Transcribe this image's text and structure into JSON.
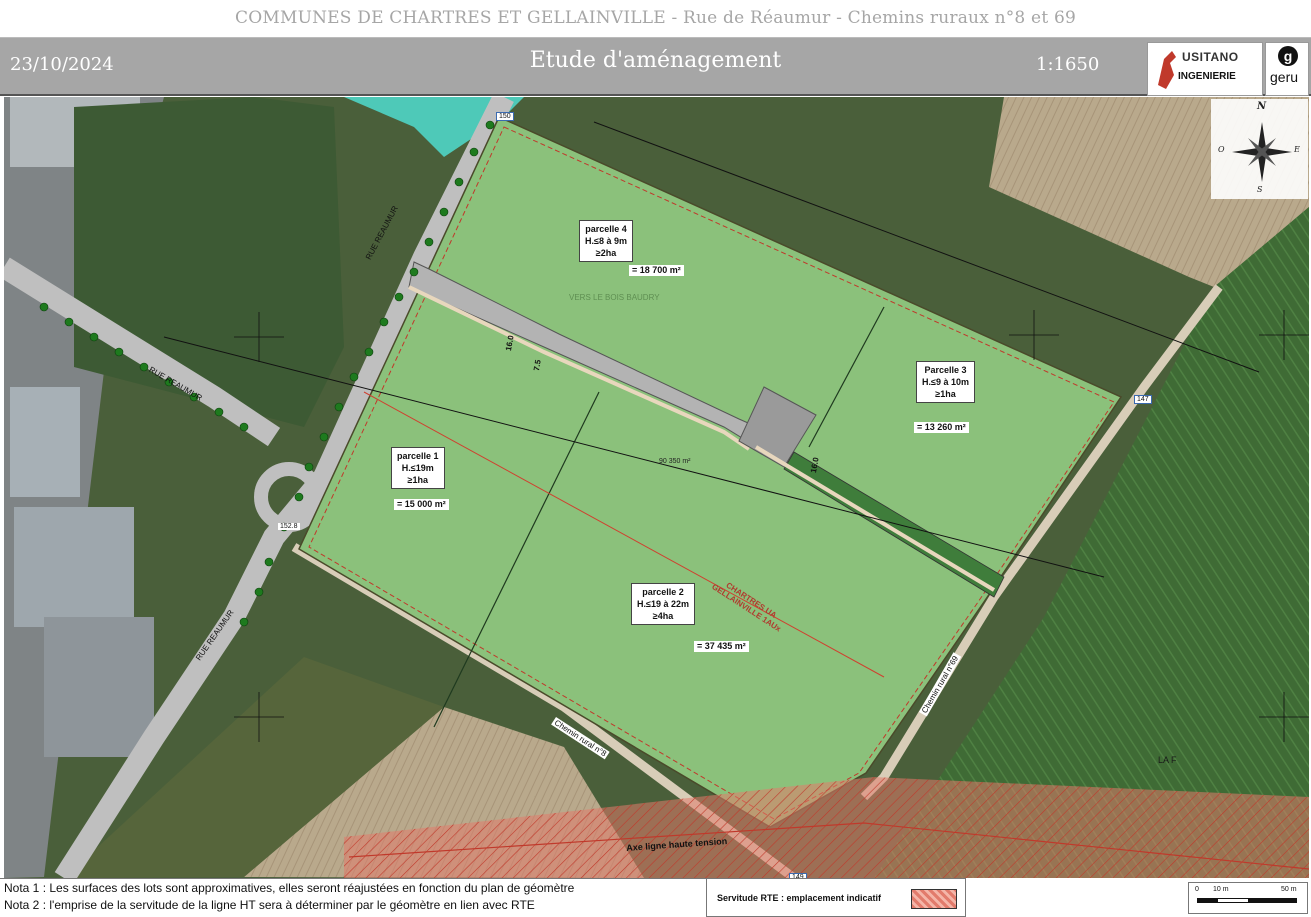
{
  "topbar": {
    "title": "COMMUNES DE CHARTRES ET GELLAINVILLE - Rue de Réaumur - Chemins ruraux n°8 et 69"
  },
  "header": {
    "date": "23/10/2024",
    "study_title": "Etude d'aménagement",
    "scale": "1:1650",
    "logo_lusitano_name": "USITANO",
    "logo_lusitano_sub": "INGENIERIE",
    "logo_geru_name": "geru"
  },
  "colors": {
    "parcel_fill": "#8bc17b",
    "strip_fill": "#3f7d3b",
    "road_fill": "#b3b3b3",
    "cadastre_red": "#c0392b",
    "servitude": "#e27b6c",
    "header_grey": "#a6a6a6"
  },
  "map": {
    "compass": {
      "n": "N",
      "e": "E",
      "s": "S",
      "o": "O"
    },
    "parcels": [
      {
        "name": "parcelle 4",
        "height_rule": "H.≤8 à 9m",
        "min_area": "≥2ha",
        "area": "= 18 700 m²"
      },
      {
        "name": "Parcelle 3",
        "height_rule": "H.≤9 à 10m",
        "min_area": "≥1ha",
        "area": "= 13 260 m²"
      },
      {
        "name": "parcelle 1",
        "height_rule": "H.≤19m",
        "min_area": "≥1ha",
        "area": "= 15 000 m²"
      },
      {
        "name": "parcelle 2",
        "height_rule": "H.≤19 à 22m",
        "min_area": "≥4ha",
        "area": "= 37 435 m²"
      }
    ],
    "labels": {
      "rue_reaumur": "RUE REAUMUR",
      "chemin_8": "Chemin rural n°8",
      "chemin_69": "Chemin rural n°69",
      "zone": "CHARTRES UA GELLAINVILLE 1AUx",
      "axe_ht": "Axe ligne haute tension",
      "total_area": "90 350 m²",
      "lieu_dit": "VERS LE BOIS BAUDRY",
      "laf": "LA F",
      "dim_16_0": "16.0",
      "dim_7_5": "7.5",
      "num_150": "150",
      "num_147": "147",
      "num_149": "149",
      "num_152": "152.8"
    }
  },
  "notes": {
    "nota1": "Nota 1 : Les surfaces des lots sont approximatives, elles seront réajustées en fonction du plan de géomètre",
    "nota2": "Nota 2 : l'emprise de la servitude de la ligne HT sera à déterminer par le géomètre en lien avec RTE"
  },
  "legend": {
    "servitude_label": "Servitude RTE : emplacement indicatif"
  },
  "scalebar": {
    "t0": "0",
    "t1": "10 m",
    "t2": "50 m"
  }
}
